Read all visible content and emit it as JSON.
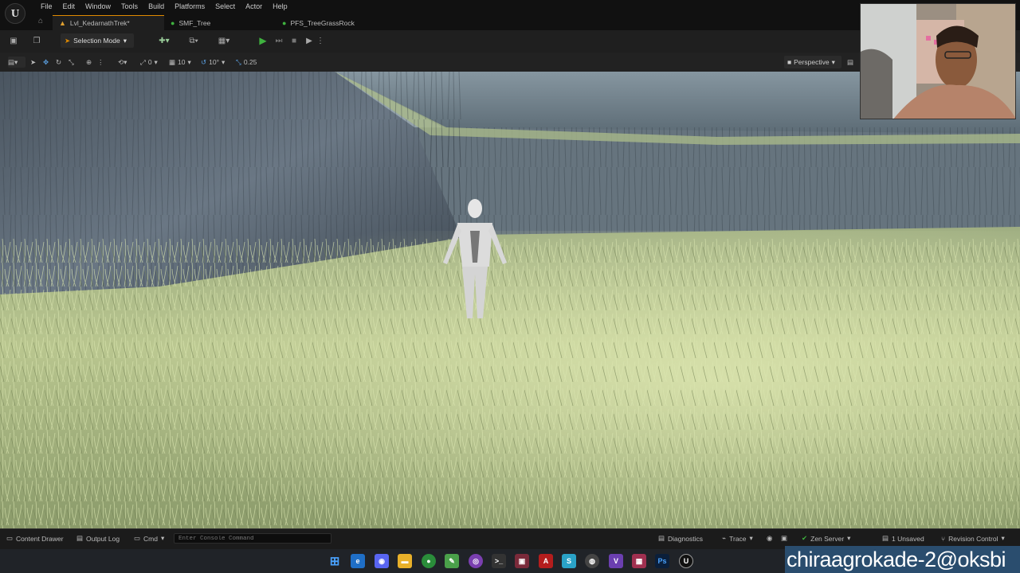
{
  "menu": [
    "File",
    "Edit",
    "Window",
    "Tools",
    "Build",
    "Platforms",
    "Select",
    "Actor",
    "Help"
  ],
  "tabs": [
    {
      "label": "Lvl_KedarnathTrek*",
      "icon": "level-icon",
      "color": "#e0a030"
    },
    {
      "label": "SMF_Tree",
      "icon": "material-icon",
      "color": "#3fb23f"
    },
    {
      "label": "PFS_TreeGrassRock",
      "icon": "material-icon",
      "color": "#3fb23f"
    }
  ],
  "toolbar": {
    "selection_mode": "Selection Mode"
  },
  "viewport_toolbar": {
    "rotate_snap": "0",
    "grid_snap": "10",
    "angle_snap": "10°",
    "scale_snap": "0.25",
    "view_mode": "Perspective"
  },
  "statusbar": {
    "content_drawer": "Content Drawer",
    "output_log": "Output Log",
    "cmd": "Cmd",
    "console_placeholder": "Enter Console Command",
    "diagnostics": "Diagnostics",
    "trace": "Trace",
    "zen_server": "Zen Server",
    "unsaved": "1 Unsaved",
    "revision_control": "Revision Control"
  },
  "taskbar_icons": [
    "windows-start-icon",
    "edge-icon",
    "discord-icon",
    "file-explorer-icon",
    "chrome-icon",
    "notepad-icon",
    "github-icon",
    "terminal-icon",
    "app-icon",
    "adobe-acrobat-icon",
    "app-icon",
    "app-icon",
    "visual-studio-icon",
    "app-icon",
    "photoshop-icon",
    "unreal-engine-icon"
  ],
  "watermark": "chiraagrokade-2@oksbi",
  "colors": {
    "accent": "#e08a00",
    "play": "#3fb23f",
    "watermark_bg": "#2a4d6e"
  }
}
